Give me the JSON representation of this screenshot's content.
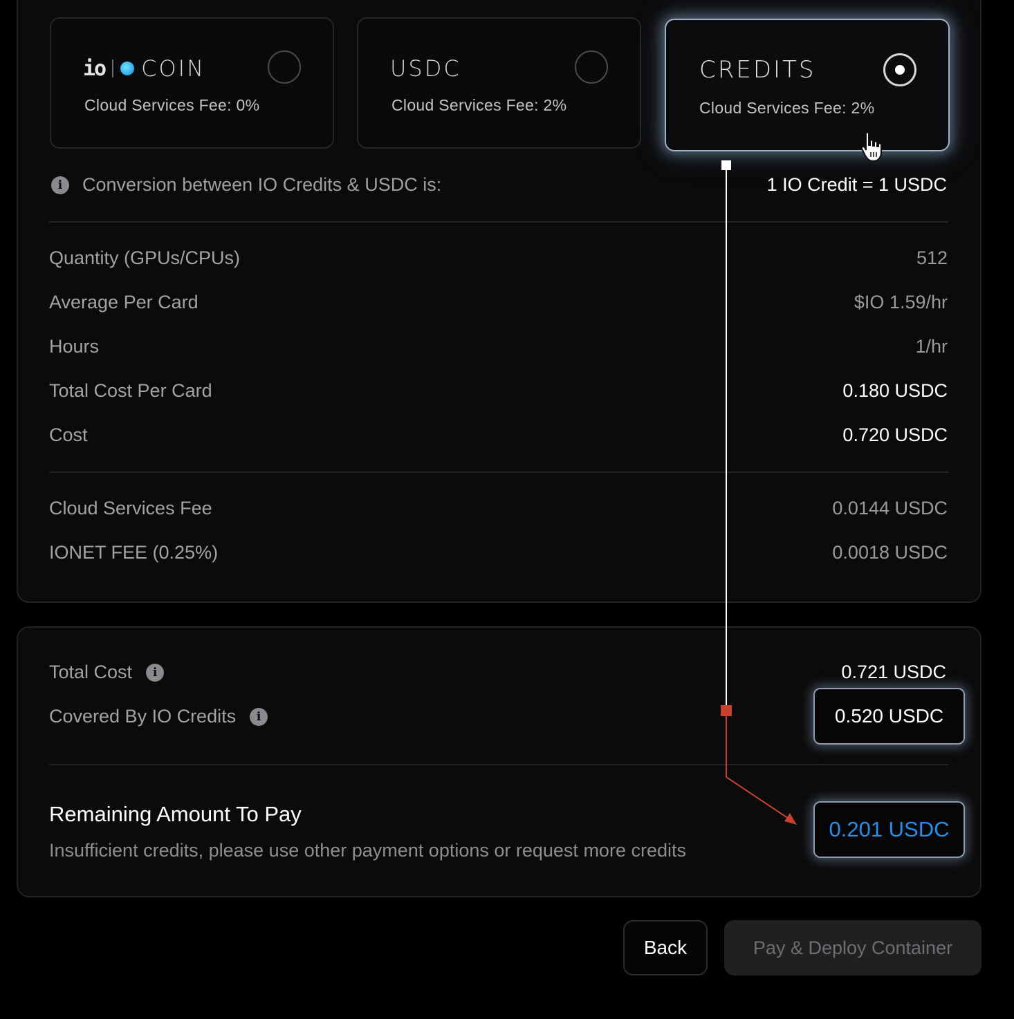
{
  "payment_options": [
    {
      "brand": "COIN",
      "logo_mark": "io",
      "fee": "Cloud Services Fee: 0%",
      "selected": false
    },
    {
      "brand": "USDC",
      "fee": "Cloud Services Fee: 2%",
      "selected": false
    },
    {
      "brand": "CREDITS",
      "fee": "Cloud Services Fee: 2%",
      "selected": true
    }
  ],
  "conversion": {
    "label": "Conversion between IO Credits & USDC is:",
    "value": "1 IO Credit = 1 USDC"
  },
  "summary_rows": [
    {
      "label": "Quantity (GPUs/CPUs)",
      "value": "512"
    },
    {
      "label": "Average Per Card",
      "value": "$IO 1.59/hr"
    },
    {
      "label": "Hours",
      "value": "1/hr"
    },
    {
      "label": "Total Cost Per Card",
      "value": "0.180 USDC"
    },
    {
      "label": "Cost",
      "value": "0.720 USDC"
    }
  ],
  "fee_rows": [
    {
      "label": "Cloud Services Fee",
      "value": "0.0144 USDC"
    },
    {
      "label": "IONET FEE (0.25%)",
      "value": "0.0018 USDC"
    }
  ],
  "totals": {
    "total_cost_label": "Total Cost",
    "total_cost_value": "0.721 USDC",
    "covered_label": "Covered By IO Credits",
    "covered_value": "0.520 USDC"
  },
  "remaining": {
    "title": "Remaining Amount To Pay",
    "message": "Insufficient credits, please use other payment options or request more credits",
    "value": "0.201 USDC"
  },
  "actions": {
    "back_label": "Back",
    "deploy_label": "Pay & Deploy Container"
  },
  "icons": {
    "info": "info-icon",
    "cursor": "hand-pointer-icon",
    "coin": "io-coin-icon"
  },
  "colors": {
    "accent_blue": "#1f8ff0",
    "annotation_red": "#c8412f",
    "annotation_white": "#ffffff"
  }
}
